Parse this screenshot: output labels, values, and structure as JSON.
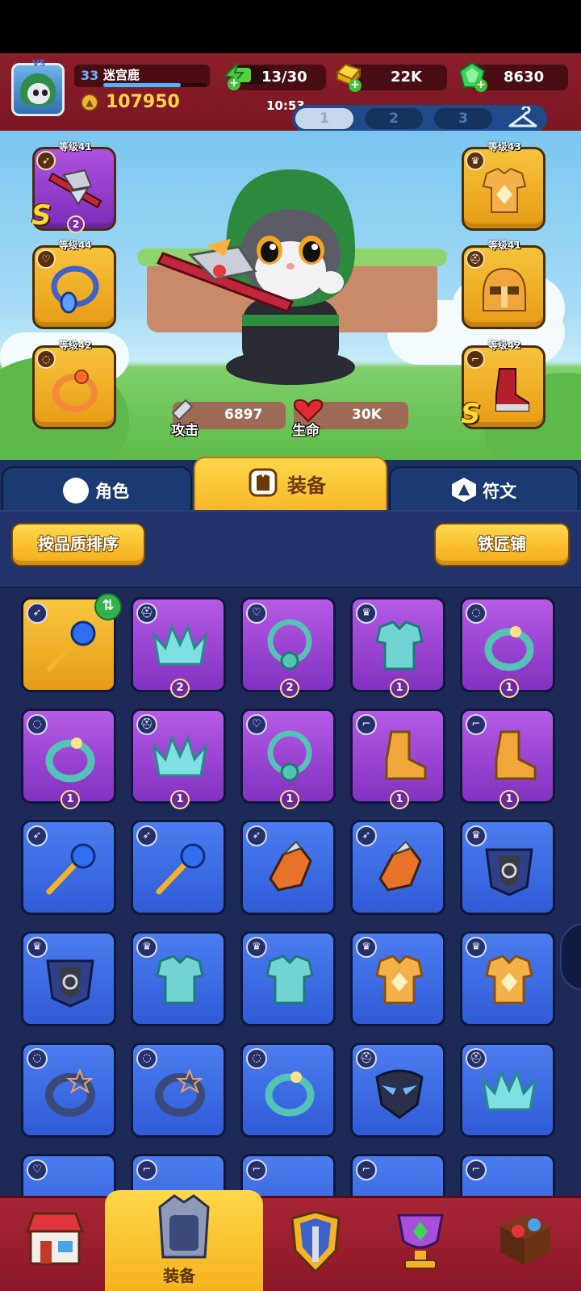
{
  "player": {
    "level": "33",
    "name": "迷宫鹿",
    "xp_fraction": 0.75,
    "power": "107950",
    "vs_tag": "VS"
  },
  "resources": {
    "energy": "13/30",
    "gold": "22K",
    "gems": "8630"
  },
  "clock": "10:53",
  "presets": [
    "1",
    "2",
    "3"
  ],
  "equipped": {
    "left": [
      {
        "level": "等级41",
        "type_icon": "bow-icon",
        "item": "crossbow",
        "rank": "S",
        "stars": "2"
      },
      {
        "level": "等级44",
        "type_icon": "amulet-icon",
        "item": "necklace"
      },
      {
        "level": "等级42",
        "type_icon": "ring-icon",
        "item": "ring"
      }
    ],
    "right": [
      {
        "level": "等级43",
        "type_icon": "armor-icon",
        "item": "armor"
      },
      {
        "level": "等级41",
        "type_icon": "helmet-icon",
        "item": "helmet"
      },
      {
        "level": "等级42",
        "type_icon": "boots-icon",
        "item": "boots",
        "rank": "S"
      }
    ]
  },
  "stats": {
    "attack_label": "攻击",
    "attack_value": "6897",
    "hp_label": "生命",
    "hp_value": "30K"
  },
  "tabs": {
    "character": "角色",
    "equipment": "装备",
    "runes": "符文"
  },
  "buttons": {
    "sort": "按品质排序",
    "blacksmith": "铁匠铺"
  },
  "inventory_counts": [
    "2",
    "2",
    "1",
    "1",
    "1",
    "1",
    "1",
    "1",
    "1"
  ],
  "nav": {
    "active_label": "装备"
  },
  "colors": {
    "gold_rarity": "#f8c73f",
    "epic_rarity": "#b55be6",
    "rare_rarity": "#4c7df0",
    "header_red": "#8a1f2a",
    "tab_active": "#ffd74a"
  }
}
